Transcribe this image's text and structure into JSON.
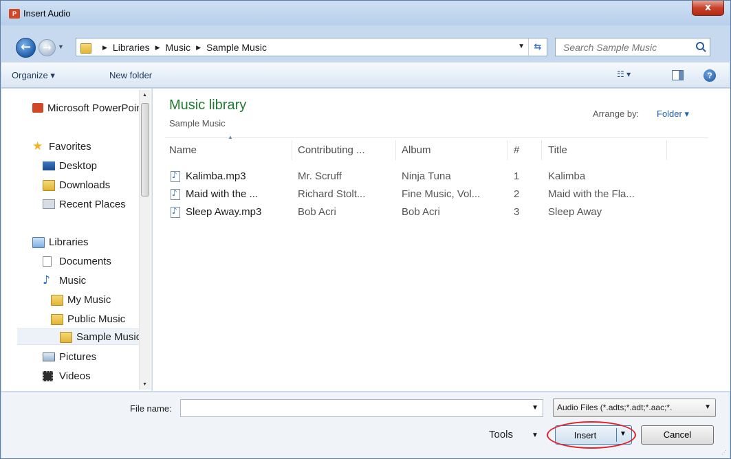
{
  "window": {
    "title": "Insert Audio",
    "app_icon": "P",
    "close": "x"
  },
  "address": {
    "crumbs": [
      "Libraries",
      "Music",
      "Sample Music"
    ],
    "search_placeholder": "Search Sample Music"
  },
  "toolbar": {
    "organize": "Organize ▾",
    "new_folder": "New folder"
  },
  "nav": {
    "items": [
      {
        "label": "Microsoft PowerPoint",
        "icon": "powerpoint-icon"
      },
      {
        "label": "Favorites",
        "icon": "star-icon"
      },
      {
        "label": "Desktop",
        "icon": "desktop-icon"
      },
      {
        "label": "Downloads",
        "icon": "downloads-folder-icon"
      },
      {
        "label": "Recent Places",
        "icon": "recent-places-icon"
      },
      {
        "label": "Libraries",
        "icon": "libraries-icon"
      },
      {
        "label": "Documents",
        "icon": "documents-icon"
      },
      {
        "label": "Music",
        "icon": "music-icon"
      },
      {
        "label": "My Music",
        "icon": "folder-icon"
      },
      {
        "label": "Public Music",
        "icon": "folder-icon"
      },
      {
        "label": "Sample Music",
        "icon": "folder-icon"
      },
      {
        "label": "Pictures",
        "icon": "pictures-icon"
      },
      {
        "label": "Videos",
        "icon": "videos-icon"
      }
    ]
  },
  "content": {
    "library_title": "Music library",
    "library_subtitle": "Sample Music",
    "arrange_label": "Arrange by:",
    "arrange_value": "Folder ▾",
    "columns": [
      "Name",
      "Contributing ...",
      "Album",
      "#",
      "Title"
    ],
    "rows": [
      {
        "name": "Kalimba.mp3",
        "artist": "Mr. Scruff",
        "album": "Ninja Tuna",
        "num": "1",
        "title": "Kalimba"
      },
      {
        "name": "Maid with the ...",
        "artist": "Richard Stolt...",
        "album": "Fine Music, Vol...",
        "num": "2",
        "title": "Maid with the Fla..."
      },
      {
        "name": "Sleep Away.mp3",
        "artist": "Bob Acri",
        "album": "Bob Acri",
        "num": "3",
        "title": "Sleep Away"
      }
    ]
  },
  "bottom": {
    "file_name_label": "File name:",
    "file_name_value": "",
    "file_type": "Audio Files (*.adts;*.adt;*.aac;*.",
    "tools": "Tools",
    "insert": "Insert",
    "cancel": "Cancel"
  },
  "colors": {
    "highlight": "#e2202c",
    "library_title": "#1e7d2e",
    "link": "#1e5fb3"
  }
}
